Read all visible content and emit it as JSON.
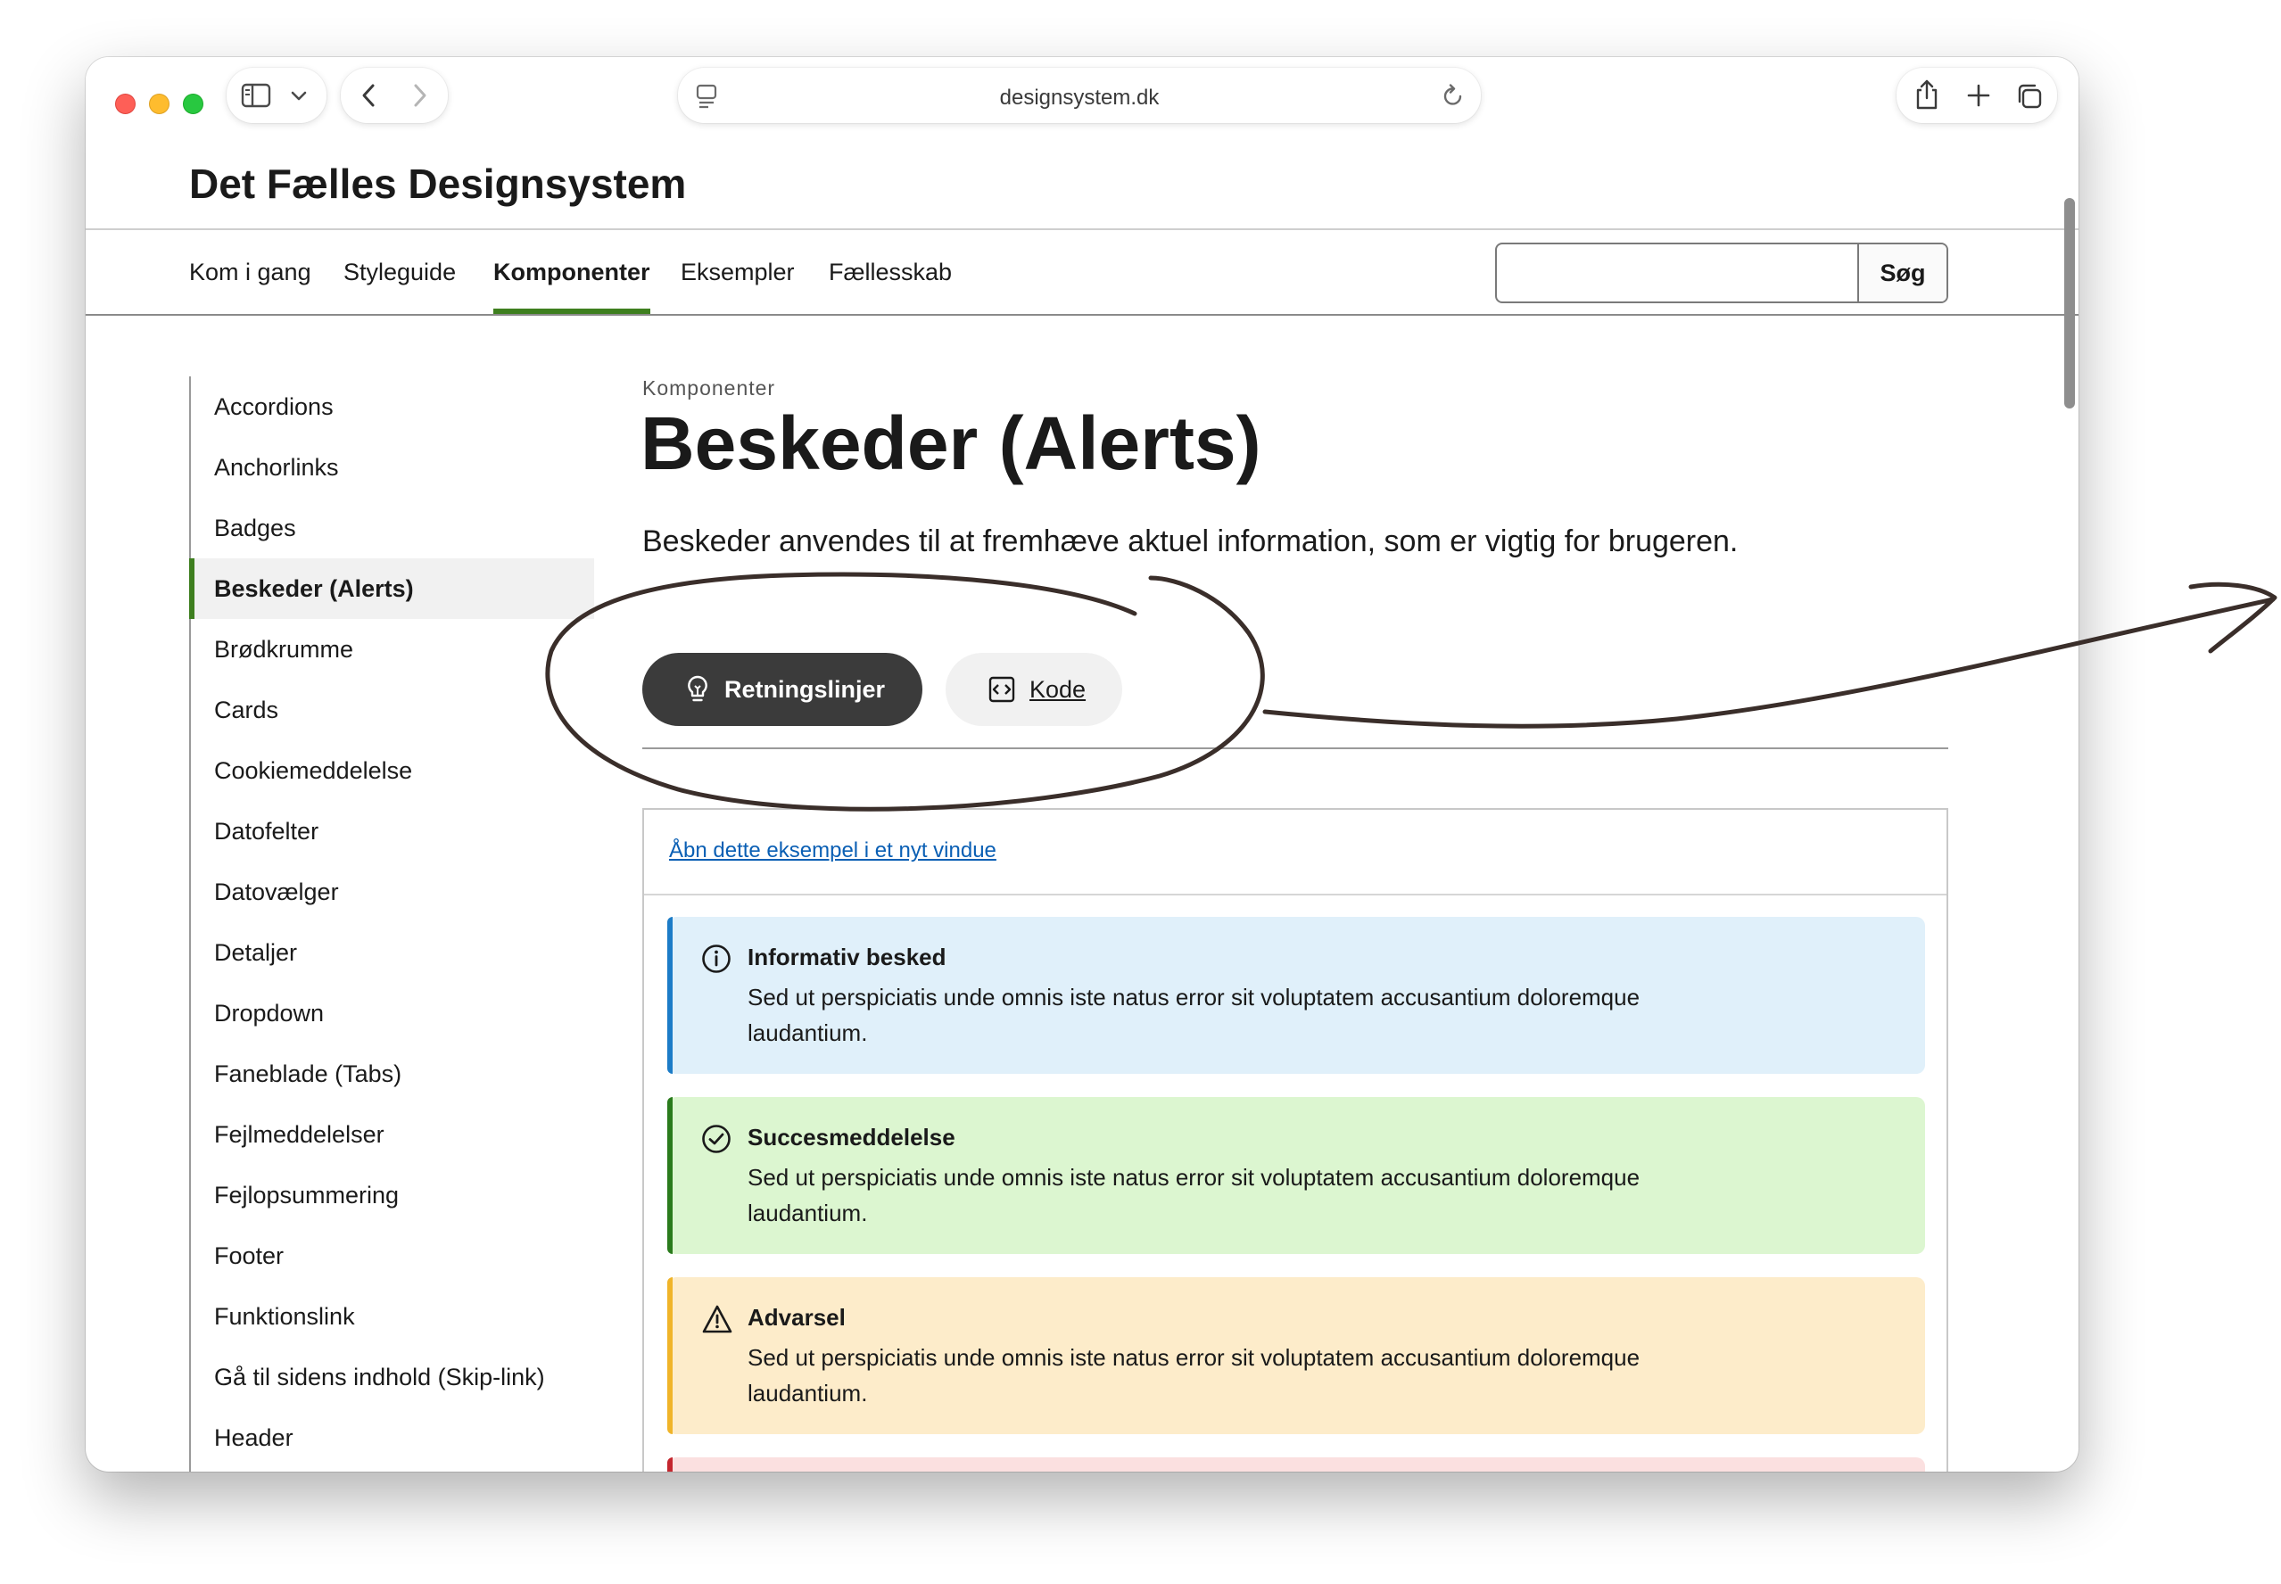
{
  "browser": {
    "url": "designsystem.dk",
    "icons": {
      "sidebar": "sidebar-toggle-icon",
      "chevron": "chevron-down-icon",
      "back": "back-arrow-icon",
      "forward": "forward-arrow-icon",
      "page": "page-menu-icon",
      "reload": "reload-icon",
      "share": "share-icon",
      "new_tab": "plus-icon",
      "tabs": "tab-overview-icon"
    }
  },
  "site": {
    "title": "Det Fælles Designsystem",
    "nav": [
      {
        "label": "Kom i gang"
      },
      {
        "label": "Styleguide"
      },
      {
        "label": "Komponenter",
        "active": true
      },
      {
        "label": "Eksempler"
      },
      {
        "label": "Fællesskab"
      }
    ],
    "search": {
      "value": "",
      "button_label": "Søg"
    }
  },
  "sidebar": {
    "items": [
      {
        "label": "Accordions"
      },
      {
        "label": "Anchorlinks"
      },
      {
        "label": "Badges"
      },
      {
        "label": "Beskeder (Alerts)",
        "active": true
      },
      {
        "label": "Brødkrumme"
      },
      {
        "label": "Cards"
      },
      {
        "label": "Cookiemeddelelse"
      },
      {
        "label": "Datofelter"
      },
      {
        "label": "Datovælger"
      },
      {
        "label": "Detaljer"
      },
      {
        "label": "Dropdown"
      },
      {
        "label": "Faneblade (Tabs)"
      },
      {
        "label": "Fejlmeddelelser"
      },
      {
        "label": "Fejlopsummering"
      },
      {
        "label": "Footer"
      },
      {
        "label": "Funktionslink"
      },
      {
        "label": "Gå til sidens indhold (Skip-link)"
      },
      {
        "label": "Header"
      }
    ]
  },
  "main": {
    "breadcrumb": "Komponenter",
    "title": "Beskeder (Alerts)",
    "lead": "Beskeder anvendes til at fremhæve aktuel information, som er vigtig for brugeren.",
    "tabs": [
      {
        "label": "Retningslinjer",
        "icon": "lightbulb-icon",
        "active": true
      },
      {
        "label": "Kode",
        "icon": "code-icon"
      }
    ],
    "example": {
      "open_link": "Åbn dette eksempel i et nyt vindue",
      "alerts": [
        {
          "type": "info",
          "icon": "info-icon",
          "title": "Informativ besked",
          "text": "Sed ut perspiciatis unde omnis iste natus error sit voluptatem accusantium doloremque laudantium."
        },
        {
          "type": "success",
          "icon": "check-circle-icon",
          "title": "Succesmeddelelse",
          "text": "Sed ut perspiciatis unde omnis iste natus error sit voluptatem accusantium doloremque laudantium."
        },
        {
          "type": "warning",
          "icon": "warning-icon",
          "title": "Advarsel",
          "text": "Sed ut perspiciatis unde omnis iste natus error sit voluptatem accusantium doloremque laudantium."
        }
      ]
    }
  },
  "colors": {
    "accent_green": "#3e7f1f",
    "info_bg": "#e0f0fa",
    "info_bar": "#1c7cc7",
    "success_bg": "#dcf6d0",
    "success_bar": "#2a7b1c",
    "warning_bg": "#fdecca",
    "warning_bar": "#f0b429",
    "error_bar": "#c4262e",
    "annotation": "#3a2e2a"
  }
}
